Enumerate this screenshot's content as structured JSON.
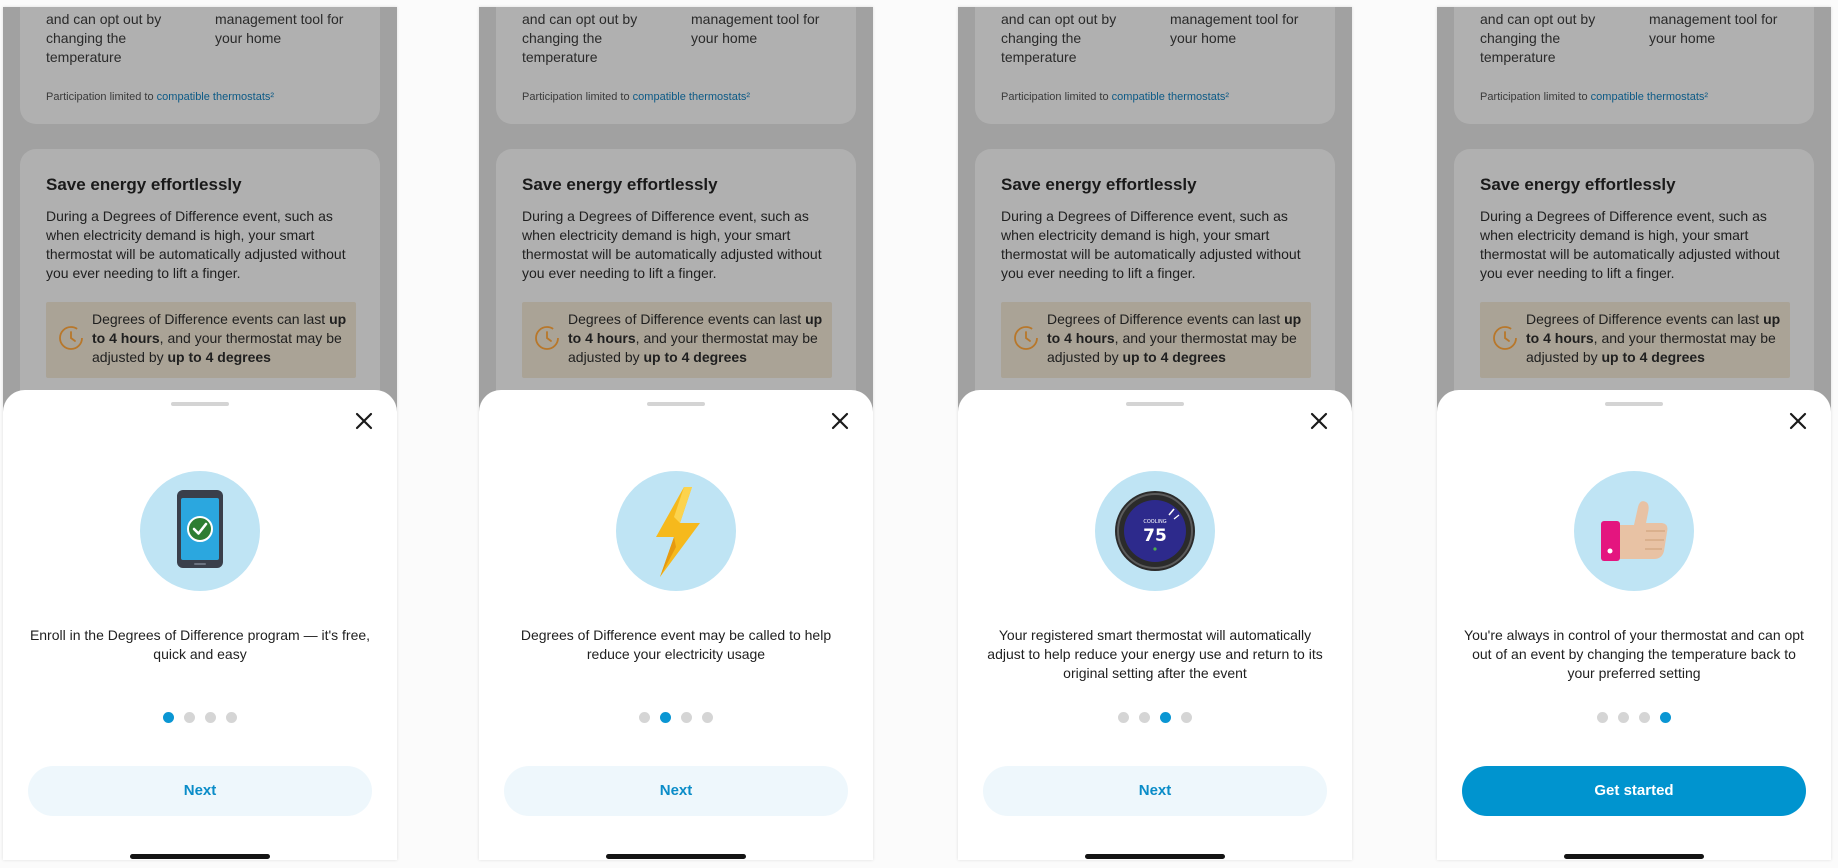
{
  "background": {
    "card1_col1": [
      "and can opt out by",
      "changing the",
      "temperature"
    ],
    "card1_col2": [
      "management tool for",
      "your home"
    ],
    "participation_prefix": "Participation limited to",
    "participation_link": "compatible thermostats²",
    "save_title": "Save energy effortlessly",
    "save_body": "During a Degrees of Difference event, such as when electricity demand is high, your smart thermostat will be automatically adjusted without you ever needing to lift a finger.",
    "note_part1": "Degrees of Difference events can last ",
    "note_bold1": "up to 4 hours",
    "note_part2": ", and your thermostat may be adjusted by ",
    "note_bold2": "up to 4 degrees"
  },
  "thermostat_display": {
    "mode": "COOLING",
    "temp": "75"
  },
  "screens": [
    {
      "illustration": "phone-check-icon",
      "caption": "Enroll in the Degrees of Difference program — it's free, quick and easy",
      "active_step": 1,
      "button": "Next",
      "primary": false
    },
    {
      "illustration": "lightning-bolt-icon",
      "caption": "Degrees of Difference event may be called to help reduce your electricity usage",
      "active_step": 2,
      "button": "Next",
      "primary": false
    },
    {
      "illustration": "thermostat-icon",
      "caption": "Your registered smart thermostat will automatically adjust to help reduce your energy use and return to its original setting after the event",
      "active_step": 3,
      "button": "Next",
      "primary": false
    },
    {
      "illustration": "thumbs-up-icon",
      "caption": "You're always in control of your thermostat and can opt out of an event by changing the temperature back to your preferred setting",
      "active_step": 4,
      "button": "Get started",
      "primary": true
    }
  ],
  "colors": {
    "accent": "#0094cf",
    "active_dot": "#0a96d3",
    "illustration_bg": "#bfe4f4",
    "overlay": "#a1a1a1"
  }
}
